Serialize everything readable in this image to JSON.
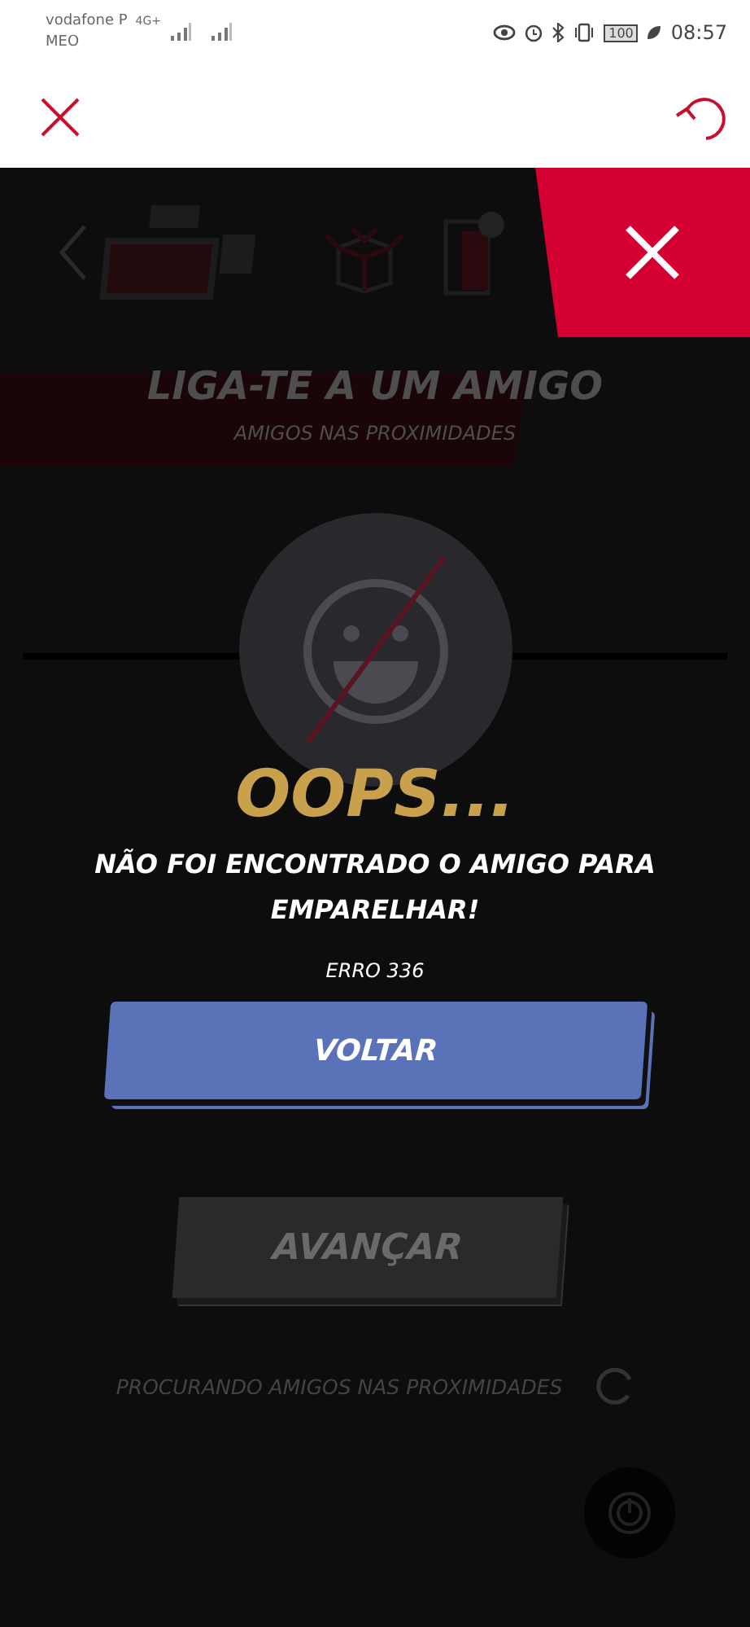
{
  "status_bar": {
    "carrier": "vodafone P",
    "carrier_2": "MEO",
    "network": "4G+",
    "battery": "100",
    "time": "08:57"
  },
  "background": {
    "title": "LIGA-TE A UM AMIGO",
    "subtitle": "AMIGOS NAS PROXIMIDADES",
    "next_button": {
      "label": "AVANÇAR",
      "disabled": true
    },
    "searching": "PROCURANDO AMIGOS NAS PROXIMIDADES"
  },
  "dialog": {
    "title": "OOPS...",
    "message": "NÃO FOI ENCONTRADO O AMIGO PARA EMPARELHAR!",
    "code": "ERRO 336",
    "button": "VOLTAR"
  }
}
